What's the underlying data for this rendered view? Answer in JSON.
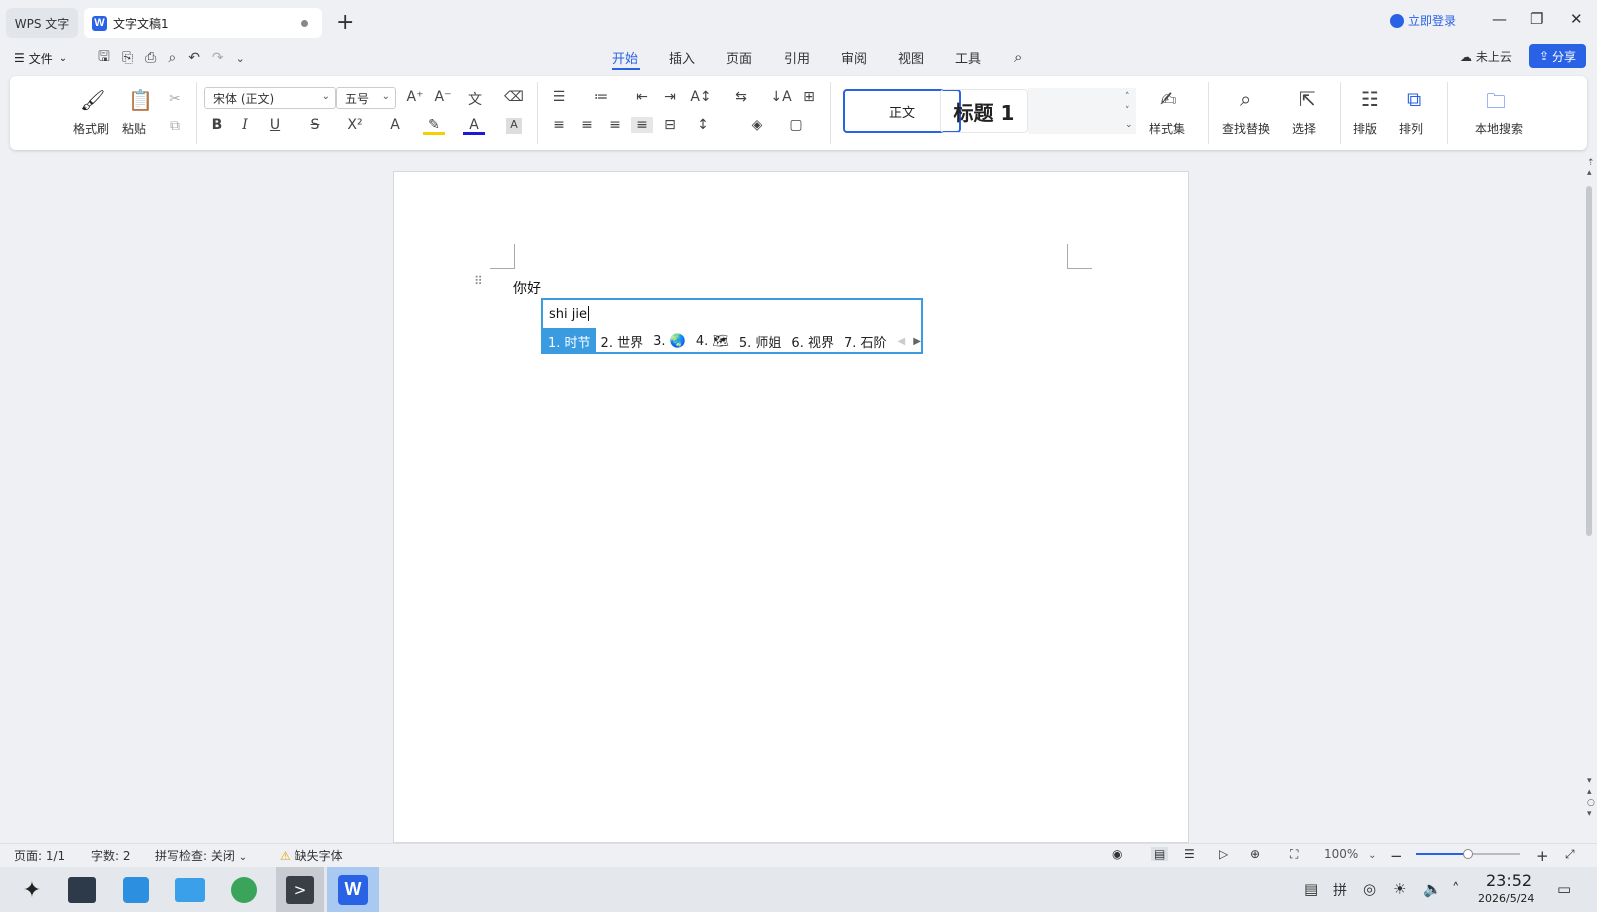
{
  "titlebar": {
    "home_tab": "WPS 文字",
    "doc_tab": "文字文稿1",
    "doc_tab_logo": "W",
    "login": "立即登录"
  },
  "menubar": {
    "file_label": "文件",
    "tabs": [
      "开始",
      "插入",
      "页面",
      "引用",
      "审阅",
      "视图",
      "工具"
    ],
    "active_tab": "开始",
    "cloud_status": "未上云",
    "share_label": "分享"
  },
  "ribbon": {
    "format_painter": "格式刷",
    "paste": "粘贴",
    "font_name": "宋体 (正文)",
    "font_size": "五号",
    "style_normal": "正文",
    "style_heading1": "标题 1",
    "style_set": "样式集",
    "find_replace": "查找替换",
    "select": "选择",
    "layout": "排版",
    "arrange": "排列",
    "local_search": "本地搜索"
  },
  "document": {
    "paragraph_text": "你好"
  },
  "ime": {
    "input": "shi jie",
    "candidates": [
      "1. 时节",
      "2. 世界",
      "3. 🌏",
      "4. 🗺",
      "5. 师姐",
      "6. 视界",
      "7. 石阶"
    ],
    "selected_index": 0
  },
  "statusbar": {
    "page": "页面: 1/1",
    "word_count": "字数: 2",
    "spell_check": "拼写检查: 关闭",
    "missing_font": "缺失字体",
    "zoom": "100%",
    "zoom_fraction": 0.5
  },
  "taskbar": {
    "time": "23:52",
    "date": "2026/5/24"
  },
  "colors": {
    "accent": "#2a62e6",
    "ime_border": "#3b9be0"
  }
}
